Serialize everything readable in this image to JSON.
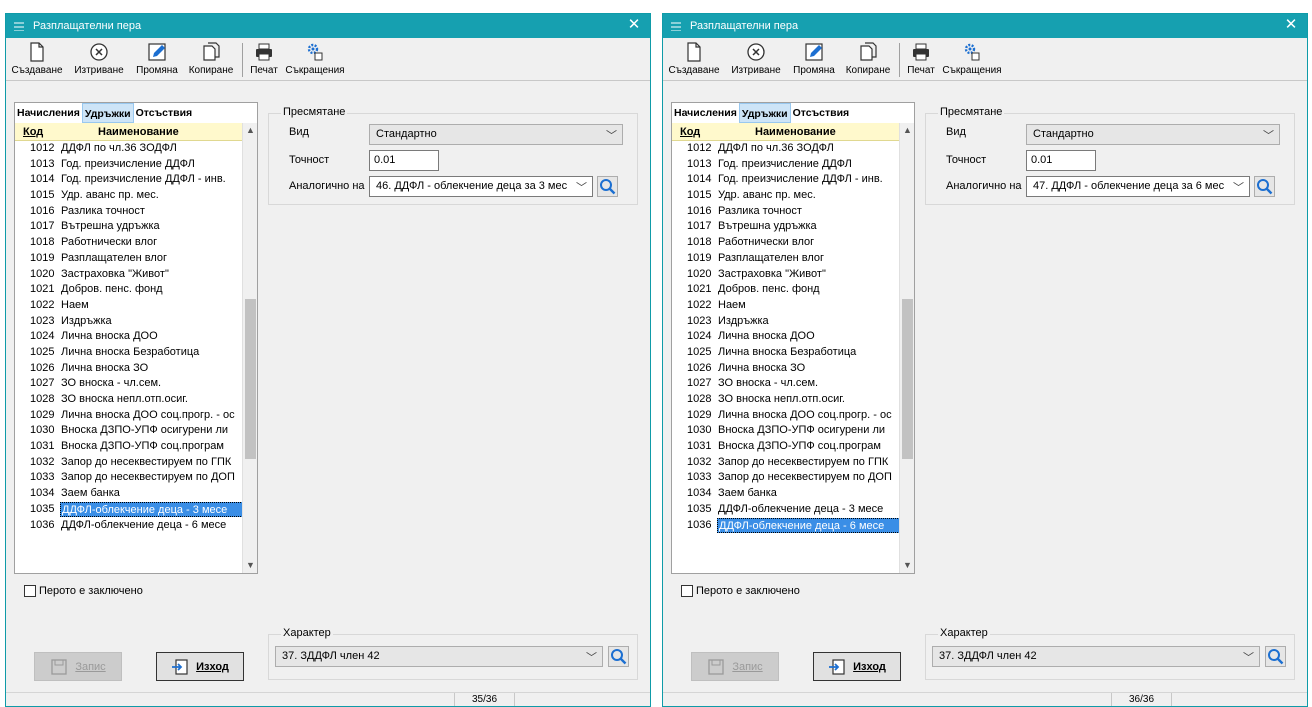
{
  "windows": [
    {
      "title": "Разплащателни пера",
      "toolbar": {
        "create": "Създаване",
        "delete": "Изтриване",
        "edit": "Промяна",
        "copy": "Копиране",
        "print": "Печат",
        "shortcuts": "Съкращения"
      },
      "tabs": [
        "Начисления",
        "Удръжки",
        "Отсъствия"
      ],
      "active_tab": 1,
      "columns": {
        "code": "Код",
        "name": "Наименование"
      },
      "rows": [
        {
          "code": "1012",
          "name": "ДДФЛ по чл.36 ЗОДФЛ"
        },
        {
          "code": "1013",
          "name": "Год. преизчисление ДДФЛ"
        },
        {
          "code": "1014",
          "name": "Год. преизчисление ДДФЛ - инв."
        },
        {
          "code": "1015",
          "name": "Удр. аванс пр. мес."
        },
        {
          "code": "1016",
          "name": "Разлика точност"
        },
        {
          "code": "1017",
          "name": "Вътрешна удръжка"
        },
        {
          "code": "1018",
          "name": "Работнически влог"
        },
        {
          "code": "1019",
          "name": "Разплащателен влог"
        },
        {
          "code": "1020",
          "name": "Застраховка \"Живот\""
        },
        {
          "code": "1021",
          "name": "Добров. пенс. фонд"
        },
        {
          "code": "1022",
          "name": "Наем"
        },
        {
          "code": "1023",
          "name": "Издръжка"
        },
        {
          "code": "1024",
          "name": "Лична вноска ДОО"
        },
        {
          "code": "1025",
          "name": "Лична вноска Безработица"
        },
        {
          "code": "1026",
          "name": "Лична вноска ЗО"
        },
        {
          "code": "1027",
          "name": "ЗО вноска - чл.сем."
        },
        {
          "code": "1028",
          "name": "ЗО вноска непл.отп.осиг."
        },
        {
          "code": "1029",
          "name": "Лична вноска ДОО соц.прогр. - ос"
        },
        {
          "code": "1030",
          "name": "Вноска ДЗПО-УПФ осигурени ли"
        },
        {
          "code": "1031",
          "name": "Вноска ДЗПО-УПФ соц.програм"
        },
        {
          "code": "1032",
          "name": "Запор до несеквестируем по ГПК"
        },
        {
          "code": "1033",
          "name": "Запор до несеквестируем по ДОП"
        },
        {
          "code": "1034",
          "name": "Заем банка"
        },
        {
          "code": "1035",
          "name": "ДДФЛ-облекчение деца - 3 месе"
        },
        {
          "code": "1036",
          "name": "ДДФЛ-облекчение деца - 6 месе"
        }
      ],
      "selected_row": 23,
      "scroll_fraction": 0.62,
      "calc": {
        "legend": "Пресмятане",
        "type_label": "Вид",
        "type_value": "Стандартно",
        "precision_label": "Точност",
        "precision_value": "0.01",
        "analog_label": "Аналогично на",
        "analog_value": "46. ДДФЛ - облекчение деца за 3 мес"
      },
      "locked_label": "Перото е заключено",
      "character": {
        "legend": "Характер",
        "value": "37. ЗДДФЛ член 42"
      },
      "save_label": "Запис",
      "exit_label": "Изход",
      "status": "35/36"
    },
    {
      "title": "Разплащателни пера",
      "toolbar": {
        "create": "Създаване",
        "delete": "Изтриване",
        "edit": "Промяна",
        "copy": "Копиране",
        "print": "Печат",
        "shortcuts": "Съкращения"
      },
      "tabs": [
        "Начисления",
        "Удръжки",
        "Отсъствия"
      ],
      "active_tab": 1,
      "columns": {
        "code": "Код",
        "name": "Наименование"
      },
      "rows": [
        {
          "code": "1012",
          "name": "ДДФЛ по чл.36 ЗОДФЛ"
        },
        {
          "code": "1013",
          "name": "Год. преизчисление ДДФЛ"
        },
        {
          "code": "1014",
          "name": "Год. преизчисление ДДФЛ - инв."
        },
        {
          "code": "1015",
          "name": "Удр. аванс пр. мес."
        },
        {
          "code": "1016",
          "name": "Разлика точност"
        },
        {
          "code": "1017",
          "name": "Вътрешна удръжка"
        },
        {
          "code": "1018",
          "name": "Работнически влог"
        },
        {
          "code": "1019",
          "name": "Разплащателен влог"
        },
        {
          "code": "1020",
          "name": "Застраховка \"Живот\""
        },
        {
          "code": "1021",
          "name": "Добров. пенс. фонд"
        },
        {
          "code": "1022",
          "name": "Наем"
        },
        {
          "code": "1023",
          "name": "Издръжка"
        },
        {
          "code": "1024",
          "name": "Лична вноска ДОО"
        },
        {
          "code": "1025",
          "name": "Лична вноска Безработица"
        },
        {
          "code": "1026",
          "name": "Лична вноска ЗО"
        },
        {
          "code": "1027",
          "name": "ЗО вноска - чл.сем."
        },
        {
          "code": "1028",
          "name": "ЗО вноска непл.отп.осиг."
        },
        {
          "code": "1029",
          "name": "Лична вноска ДОО соц.прогр. - ос"
        },
        {
          "code": "1030",
          "name": "Вноска ДЗПО-УПФ осигурени ли"
        },
        {
          "code": "1031",
          "name": "Вноска ДЗПО-УПФ соц.програм"
        },
        {
          "code": "1032",
          "name": "Запор до несеквестируем по ГПК"
        },
        {
          "code": "1033",
          "name": "Запор до несеквестируем по ДОП"
        },
        {
          "code": "1034",
          "name": "Заем банка"
        },
        {
          "code": "1035",
          "name": "ДДФЛ-облекчение деца - 3 месе"
        },
        {
          "code": "1036",
          "name": "ДДФЛ-облекчение деца - 6 месе"
        }
      ],
      "selected_row": 24,
      "scroll_fraction": 0.62,
      "calc": {
        "legend": "Пресмятане",
        "type_label": "Вид",
        "type_value": "Стандартно",
        "precision_label": "Точност",
        "precision_value": "0.01",
        "analog_label": "Аналогично на",
        "analog_value": "47. ДДФЛ - облекчение деца за 6 мес"
      },
      "locked_label": "Перото е заключено",
      "character": {
        "legend": "Характер",
        "value": "37. ЗДДФЛ член 42"
      },
      "save_label": "Запис",
      "exit_label": "Изход",
      "status": "36/36"
    }
  ]
}
